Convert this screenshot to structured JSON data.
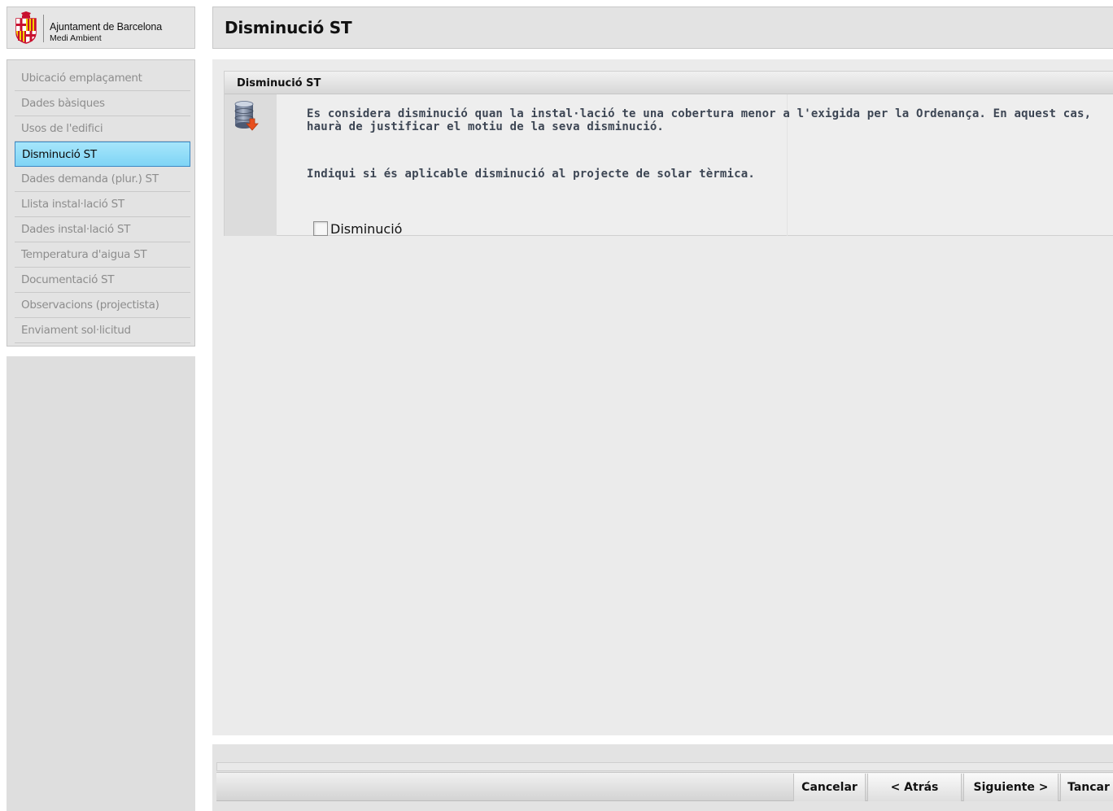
{
  "brand": {
    "name": "Ajuntament de Barcelona",
    "department": "Medi Ambient",
    "emblem_icon": "barcelona-coat-of-arms-icon"
  },
  "sidebar": {
    "items": [
      {
        "label": "Ubicació emplaçament",
        "active": false
      },
      {
        "label": "Dades bàsiques",
        "active": false
      },
      {
        "label": "Usos de l'edifici",
        "active": false
      },
      {
        "label": "Disminució ST",
        "active": true
      },
      {
        "label": "Dades demanda (plur.) ST",
        "active": false
      },
      {
        "label": "Llista instal·lació ST",
        "active": false
      },
      {
        "label": "Dades instal·lació ST",
        "active": false
      },
      {
        "label": "Temperatura d'aigua ST",
        "active": false
      },
      {
        "label": "Documentació ST",
        "active": false
      },
      {
        "label": "Observacions (projectista)",
        "active": false
      },
      {
        "label": "Enviament sol·licitud",
        "active": false
      }
    ]
  },
  "header": {
    "title": "Disminució ST"
  },
  "panel": {
    "title": "Disminució ST",
    "icon": "database-download-icon",
    "description": "Es considera disminució quan la instal·lació te una cobertura menor a l'exigida per la Ordenança. En aquest cas, haurà de justificar el motiu de la seva disminució.",
    "instruction": "Indiqui si és aplicable disminució al projecte de solar tèrmica.",
    "checkbox_label": "Disminució",
    "checkbox_checked": false
  },
  "footer": {
    "cancel_label": "Cancelar",
    "back_label": "< Atrás",
    "next_label": "Siguiente >",
    "close_label": "Tancar"
  },
  "colors": {
    "active_item": "#8fdbf7",
    "active_border": "#3c89c4",
    "panel_text": "#3d4654",
    "muted_nav_text": "#8d8d8d"
  }
}
